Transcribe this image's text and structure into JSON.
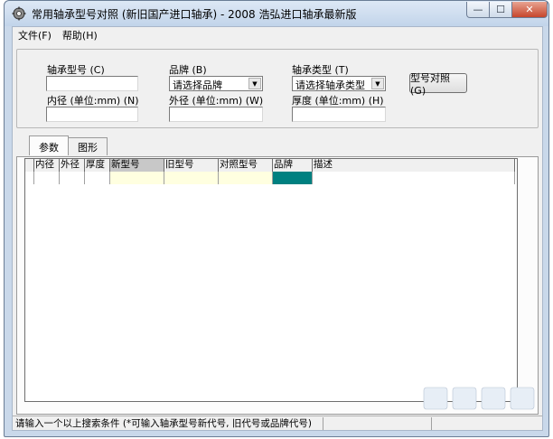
{
  "window": {
    "title": "常用轴承型号对照 (新旧国产进口轴承) - 2008 浩弘进口轴承最新版",
    "min_glyph": "—",
    "max_glyph": "☐",
    "close_glyph": "✕"
  },
  "menu": [
    {
      "label": "文件(F)"
    },
    {
      "label": "帮助(H)"
    }
  ],
  "form": {
    "model_label": "轴承型号 (C)",
    "model_value": "",
    "brand_label": "品牌 (B)",
    "brand_value": "请选择品牌",
    "type_label": "轴承类型 (T)",
    "type_value": "请选择轴承类型",
    "compare_button": "型号对照 (G)",
    "inner_label": "内径 (单位:mm) (N)",
    "inner_value": "",
    "outer_label": "外径 (单位:mm) (W)",
    "outer_value": "",
    "thickness_label": "厚度 (单位:mm) (H)",
    "thickness_value": ""
  },
  "tabs": [
    {
      "label": "参数"
    },
    {
      "label": "图形"
    }
  ],
  "grid": {
    "columns": [
      "",
      "内径",
      "外径",
      "厚度",
      "新型号",
      "旧型号",
      "对照型号",
      "品牌",
      "描述"
    ],
    "column_colors": [
      "#ffffff",
      "#ffffff",
      "#ffffff",
      "#ffffff",
      "#ffffe0",
      "#ffffe0",
      "#ffffe0",
      "#008080",
      "#ffffff"
    ]
  },
  "status": {
    "text": "请输入一个以上搜索条件 (*可输入轴承型号新代号, 旧代号或品牌代号)"
  },
  "colors": {
    "accent_teal": "#008080",
    "highlight_yellow": "#ffffe0",
    "header_selected": "#c8c8c8"
  }
}
